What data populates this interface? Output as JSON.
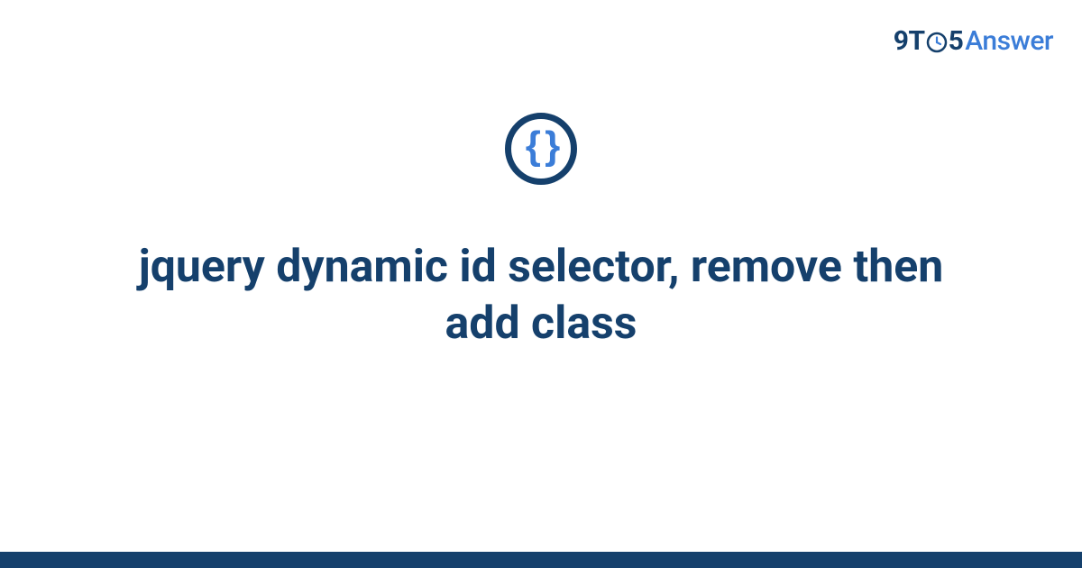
{
  "logo": {
    "part1": "9T",
    "part2": "5",
    "part3": "Answer"
  },
  "icon": {
    "symbol": "{ }",
    "name": "code-braces"
  },
  "title": "jquery dynamic id selector, remove then add class",
  "colors": {
    "dark_blue": "#15406c",
    "light_blue": "#3b7dd8",
    "background": "#ffffff"
  }
}
